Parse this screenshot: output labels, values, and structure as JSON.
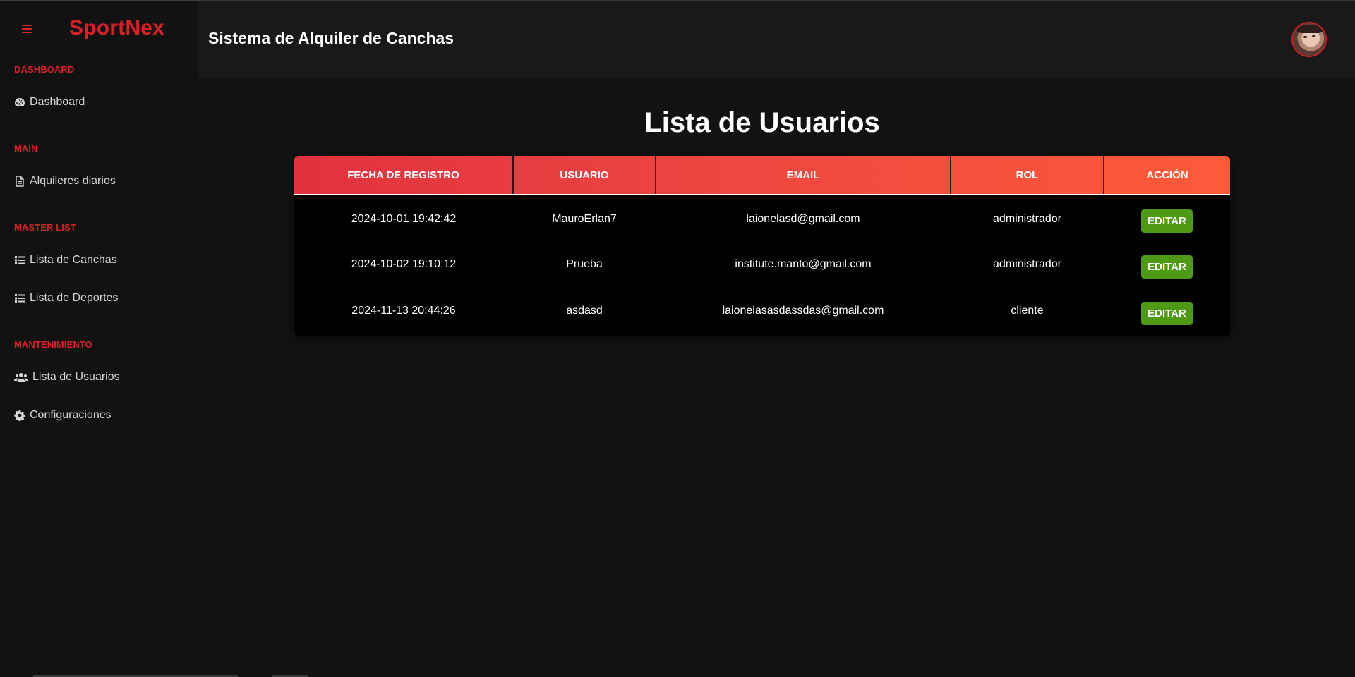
{
  "app": {
    "brand": "SportNex",
    "header_title": "Sistema de Alquiler de Canchas"
  },
  "sidebar": {
    "sections": [
      {
        "label": "DASHBOARD",
        "items": [
          {
            "label": "Dashboard",
            "icon": "gauge-icon"
          }
        ]
      },
      {
        "label": "MAIN",
        "items": [
          {
            "label": "Alquileres diarios",
            "icon": "document-icon"
          }
        ]
      },
      {
        "label": "MASTER LIST",
        "items": [
          {
            "label": "Lista de Canchas",
            "icon": "list-icon"
          },
          {
            "label": "Lista de Deportes",
            "icon": "list-icon"
          }
        ]
      },
      {
        "label": "MANTENIMIENTO",
        "items": [
          {
            "label": "Lista de Usuarios",
            "icon": "users-icon"
          },
          {
            "label": "Configuraciones",
            "icon": "gear-icon"
          }
        ]
      }
    ]
  },
  "main": {
    "title": "Lista de Usuarios",
    "table": {
      "columns": [
        "FECHA DE REGISTRO",
        "USUARIO",
        "EMAIL",
        "ROL",
        "ACCIÓN"
      ],
      "rows": [
        {
          "fecha": "2024-10-01 19:42:42",
          "usuario": "MauroErlan7",
          "email": "laionelasd@gmail.com",
          "rol": "administrador",
          "accion": "EDITAR"
        },
        {
          "fecha": "2024-10-02 19:10:12",
          "usuario": "Prueba",
          "email": "institute.manto@gmail.com",
          "rol": "administrador",
          "accion": "EDITAR"
        },
        {
          "fecha": "2024-11-13 20:44:26",
          "usuario": "asdasd",
          "email": "laionelasasdassdas@gmail.com",
          "rol": "cliente",
          "accion": "EDITAR"
        }
      ]
    }
  },
  "colors": {
    "brand_red": "#d8202a",
    "header_gradient_start": "#e0323f",
    "header_gradient_end": "#ff5a3a",
    "edit_button": "#4f9a14",
    "background": "#121212"
  }
}
